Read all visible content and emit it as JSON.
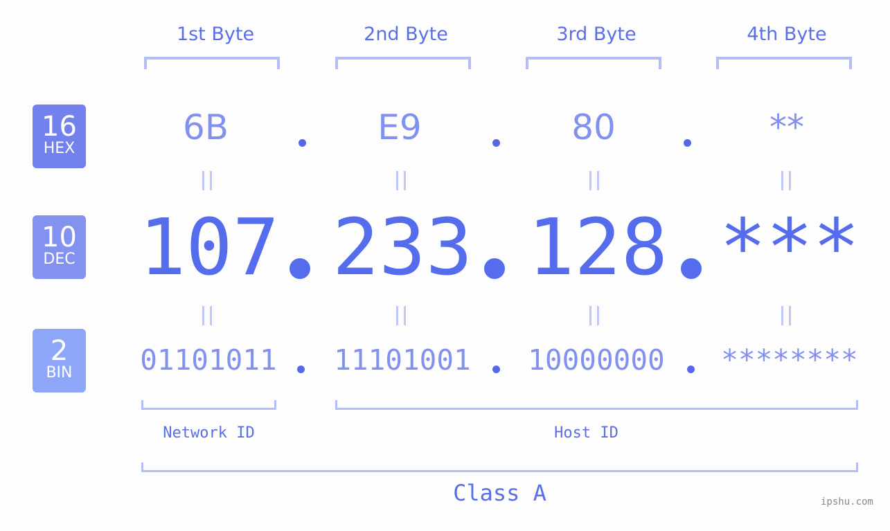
{
  "bytes": {
    "labels": [
      "1st Byte",
      "2nd Byte",
      "3rd Byte",
      "4th Byte"
    ]
  },
  "badges": {
    "hex": {
      "number": "16",
      "label": "HEX",
      "color": "#7281ed"
    },
    "dec": {
      "number": "10",
      "label": "DEC",
      "color": "#8391ef"
    },
    "bin": {
      "number": "2",
      "label": "BIN",
      "color": "#8ea6f8"
    }
  },
  "hex_values": [
    "6B",
    "E9",
    "80",
    "**"
  ],
  "dec_values": [
    "107",
    "233",
    "128",
    "***"
  ],
  "bin_values": [
    "01101011",
    "11101001",
    "10000000",
    "********"
  ],
  "separator": ".",
  "equals_symbol": "=",
  "network_id_label": "Network ID",
  "host_id_label": "Host ID",
  "class_label": "Class A",
  "watermark": "ipshu.com",
  "colors": {
    "accent": "#556cec",
    "light_accent": "#8391ee",
    "bracket": "#b4bef6",
    "background": "#fcfdfc"
  }
}
